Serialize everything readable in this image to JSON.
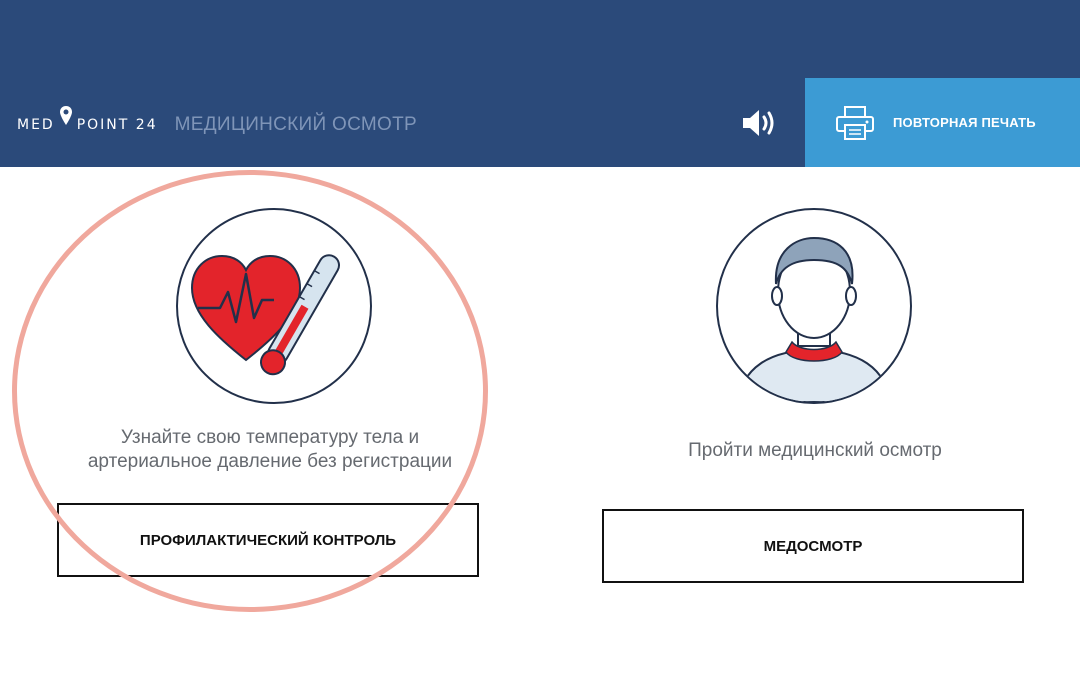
{
  "header": {
    "logo_left": "MED",
    "logo_right": "POINT 24",
    "title": "МЕДИЦИНСКИЙ ОСМОТР",
    "sound_icon": "speaker-icon",
    "reprint_label": "ПОВТОРНАЯ ПЕЧАТЬ",
    "reprint_icon": "printer-icon"
  },
  "options": [
    {
      "icon": "heart-thermometer-icon",
      "caption_line1": "Узнайте свою температуру тела и",
      "caption_line2": "артериальное давление без регистрации",
      "button_label": "ПРОФИЛАКТИЧЕСКИЙ КОНТРОЛЬ",
      "highlighted": true
    },
    {
      "icon": "person-avatar-icon",
      "caption_line1": "Пройти медицинский осмотр",
      "button_label": "МЕДОСМОТР",
      "highlighted": false
    }
  ],
  "colors": {
    "header_bg": "#2b4a7a",
    "reprint_bg": "#3c9bd4",
    "highlight": "#f0a89d",
    "heart": "#e3242b"
  }
}
